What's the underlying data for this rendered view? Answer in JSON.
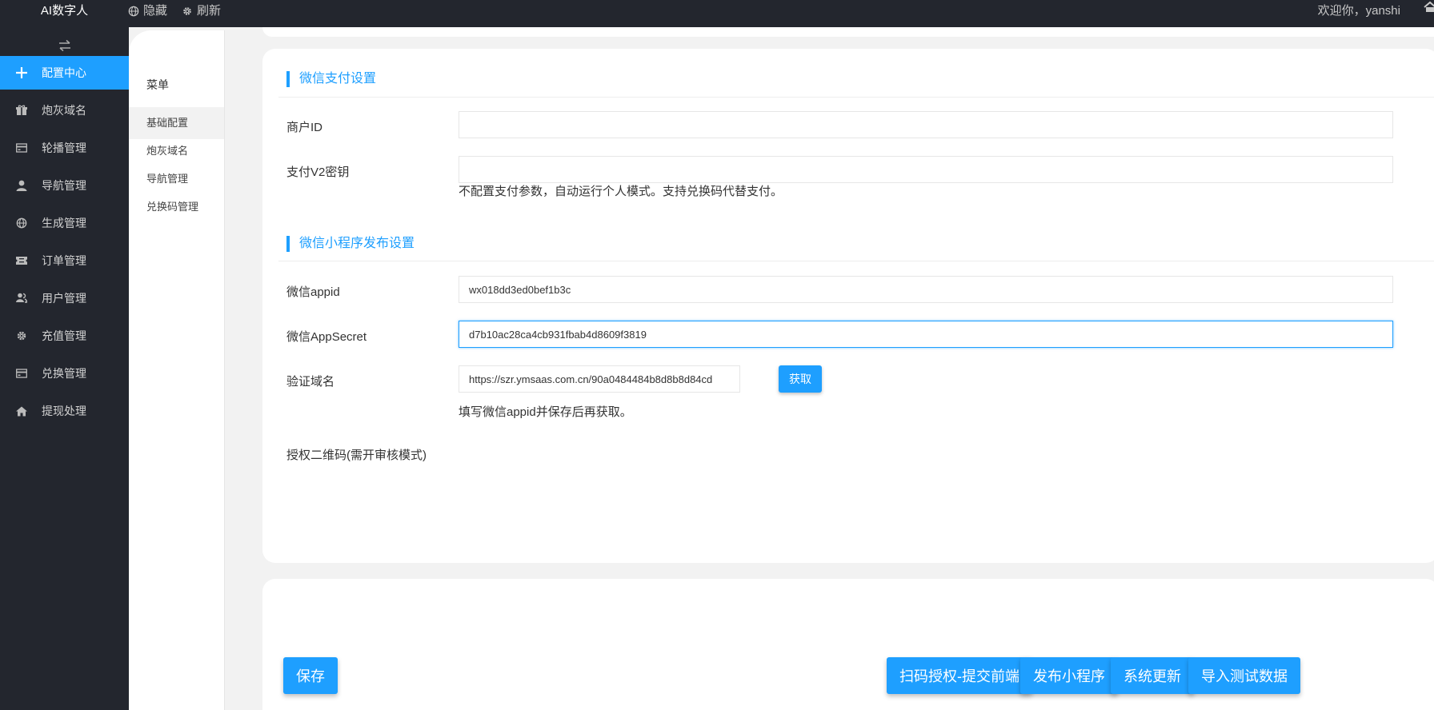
{
  "header": {
    "brand": "AI数字人",
    "hide_label": "隐藏",
    "refresh_label": "刷新",
    "welcome": "欢迎你，yanshi"
  },
  "sidebar": {
    "items": [
      {
        "label": "配置中心",
        "icon": "plus-icon",
        "active": true
      },
      {
        "label": "炮灰域名",
        "icon": "gift-icon"
      },
      {
        "label": "轮播管理",
        "icon": "card-icon"
      },
      {
        "label": "导航管理",
        "icon": "user-icon"
      },
      {
        "label": "生成管理",
        "icon": "globe-icon"
      },
      {
        "label": "订单管理",
        "icon": "ticket-icon"
      },
      {
        "label": "用户管理",
        "icon": "user-group-icon"
      },
      {
        "label": "充值管理",
        "icon": "gear-icon"
      },
      {
        "label": "兑换管理",
        "icon": "card-icon"
      },
      {
        "label": "提现处理",
        "icon": "home-icon"
      }
    ]
  },
  "submenu": {
    "title": "菜单",
    "items": [
      {
        "label": "基础配置",
        "active": true
      },
      {
        "label": "炮灰域名"
      },
      {
        "label": "导航管理"
      },
      {
        "label": "兑换码管理"
      }
    ]
  },
  "wechat_pay": {
    "title": "微信支付设置",
    "merchant_id_label": "商户ID",
    "merchant_id_value": "",
    "v2_key_label": "支付V2密钥",
    "v2_key_value": "",
    "hint": "不配置支付参数，自动运行个人模式。支持兑换码代替支付。"
  },
  "miniprogram": {
    "title": "微信小程序发布设置",
    "appid_label": "微信appid",
    "appid_value": "wx018dd3ed0bef1b3c",
    "appsecret_label": "微信AppSecret",
    "appsecret_value": "d7b10ac28ca4cb931fbab4d8609f3819",
    "domain_label": "验证域名",
    "domain_value": "https://szr.ymsaas.com.cn/90a0484484b8d8b8d84cd",
    "fetch_button": "获取",
    "domain_hint": "填写微信appid并保存后再获取。",
    "qrcode_label": "授权二维码(需开审核模式)"
  },
  "actions": {
    "save": "保存",
    "scan_auth": "扫码授权-提交前端",
    "publish": "发布小程序",
    "update": "系统更新",
    "import_test": "导入测试数据"
  },
  "colors": {
    "accent": "#1e9fff",
    "sidebar_bg": "#23262e"
  }
}
